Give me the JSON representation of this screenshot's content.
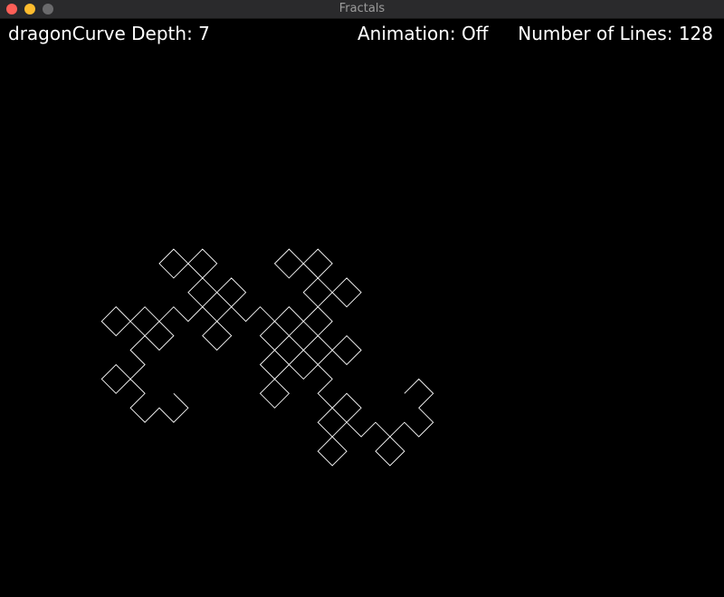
{
  "window": {
    "title": "Fractals",
    "controls": [
      "close",
      "minimize",
      "maximize"
    ]
  },
  "hud": {
    "fractal": "dragonCurve",
    "depth_label": "Depth:",
    "depth": "7",
    "animation_label": "Animation:",
    "animation": "Off",
    "lines_label": "Number of Lines:",
    "lines": "128"
  },
  "colors": {
    "background": "#000000",
    "stroke": "#ffffff",
    "hud_text": "#ffffff"
  }
}
